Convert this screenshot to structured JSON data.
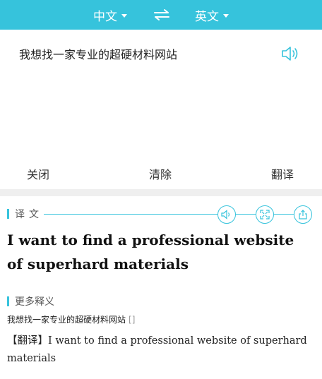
{
  "topbar": {
    "source_lang": "中文",
    "target_lang": "英文",
    "swap_icon": "swap-arrows-icon"
  },
  "input": {
    "text": "我想找一家专业的超硬材料网站",
    "speaker_icon": "speaker-icon"
  },
  "actions": {
    "close_label": "关闭",
    "clear_label": "清除",
    "translate_label": "翻译"
  },
  "translation": {
    "section_label": "译文",
    "result": "I want to find a professional website of superhard materials",
    "icons": [
      "speaker-icon",
      "fullscreen-icon",
      "share-icon"
    ]
  },
  "more": {
    "section_label": "更多释义",
    "source": "我想找一家专业的超硬材料网站",
    "bracket": "[]",
    "tag": "【翻译】",
    "translation": "I want to find a professional website of superhard materials"
  },
  "colors": {
    "accent": "#36c3dc",
    "divider": "#efefef"
  }
}
